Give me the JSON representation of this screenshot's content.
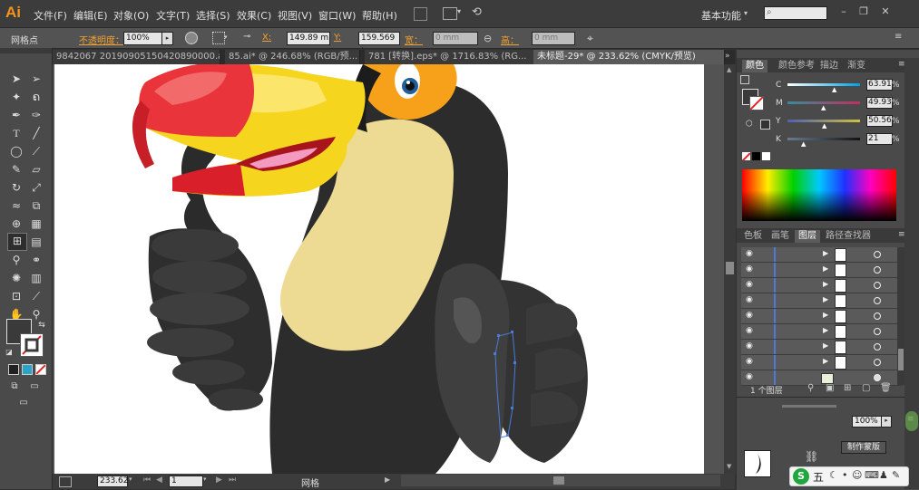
{
  "app": {
    "logo": "Ai"
  },
  "menu": [
    "文件(F)",
    "编辑(E)",
    "对象(O)",
    "文字(T)",
    "选择(S)",
    "效果(C)",
    "视图(V)",
    "窗口(W)",
    "帮助(H)"
  ],
  "workspace": "基本功能",
  "control_bar": {
    "selection_label": "网格点",
    "opacity_label": "不透明度：",
    "opacity_value": "100%",
    "x_label": "X:",
    "x_value": "149.89 m",
    "y_label": "Y:",
    "y_value": "159.569 :",
    "w_label": "宽：",
    "w_value": "0 mm",
    "h_label": "高：",
    "h_value": "0 mm"
  },
  "doc_tabs": [
    {
      "label": "9842067 20190905150420890000.ai*"
    },
    {
      "label": "85.ai* @ 246.68% (RGB/预..."
    },
    {
      "label": "781 [转换].eps* @ 1716.83% (RG..."
    },
    {
      "label": "未标题-29* @ 233.62% (CMYK/预览)"
    }
  ],
  "status_bar": {
    "zoom": "233.62",
    "page": "1",
    "mode": "网格"
  },
  "color_panel": {
    "tabs": [
      "颜色",
      "颜色参考",
      "描边",
      "渐变"
    ],
    "channels": [
      {
        "name": "C",
        "value": "63.91",
        "unit": "%"
      },
      {
        "name": "M",
        "value": "49.93",
        "unit": "%"
      },
      {
        "name": "Y",
        "value": "50.56",
        "unit": "%"
      },
      {
        "name": "K",
        "value": "21",
        "unit": "%"
      }
    ]
  },
  "layers_panel": {
    "tabs": [
      "色板",
      "画笔",
      "图层",
      "路径查找器"
    ],
    "footer": "1 个图层",
    "opacity_value": "100%",
    "make_mask_button": "制作蒙版"
  },
  "ime_bar": {
    "label": "五"
  },
  "colors": {
    "accent_orange": "#f7931e",
    "selection_blue": "#4a7bd8",
    "artboard": "#ffffff"
  }
}
